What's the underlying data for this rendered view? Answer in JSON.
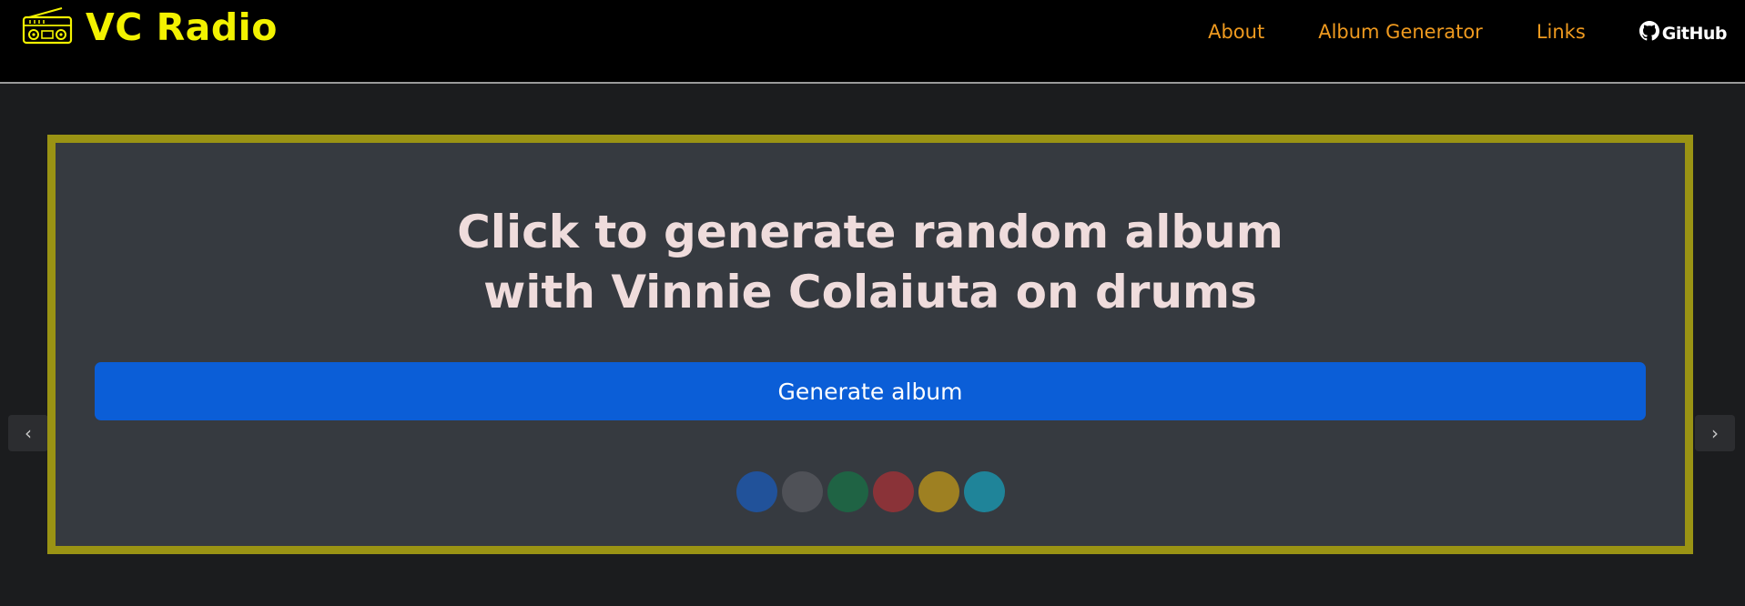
{
  "header": {
    "brand": "VC Radio",
    "nav": [
      {
        "label": "About"
      },
      {
        "label": "Album Generator"
      },
      {
        "label": "Links"
      }
    ],
    "github_label": "GitHub"
  },
  "main": {
    "headline_line1": "Click to generate random album",
    "headline_line2": "with Vinnie Colaiuta on drums",
    "generate_button": "Generate album",
    "indicator_colors": [
      "#21529a",
      "#4f5157",
      "#1f6344",
      "#8a3338",
      "#9e8022",
      "#1f8499"
    ],
    "prev_symbol": "‹",
    "next_symbol": "›"
  },
  "colors": {
    "brand": "#f3f200",
    "nav_link": "#ef9a1f",
    "frame_border": "#9a9314",
    "button": "#0b5ed7"
  }
}
